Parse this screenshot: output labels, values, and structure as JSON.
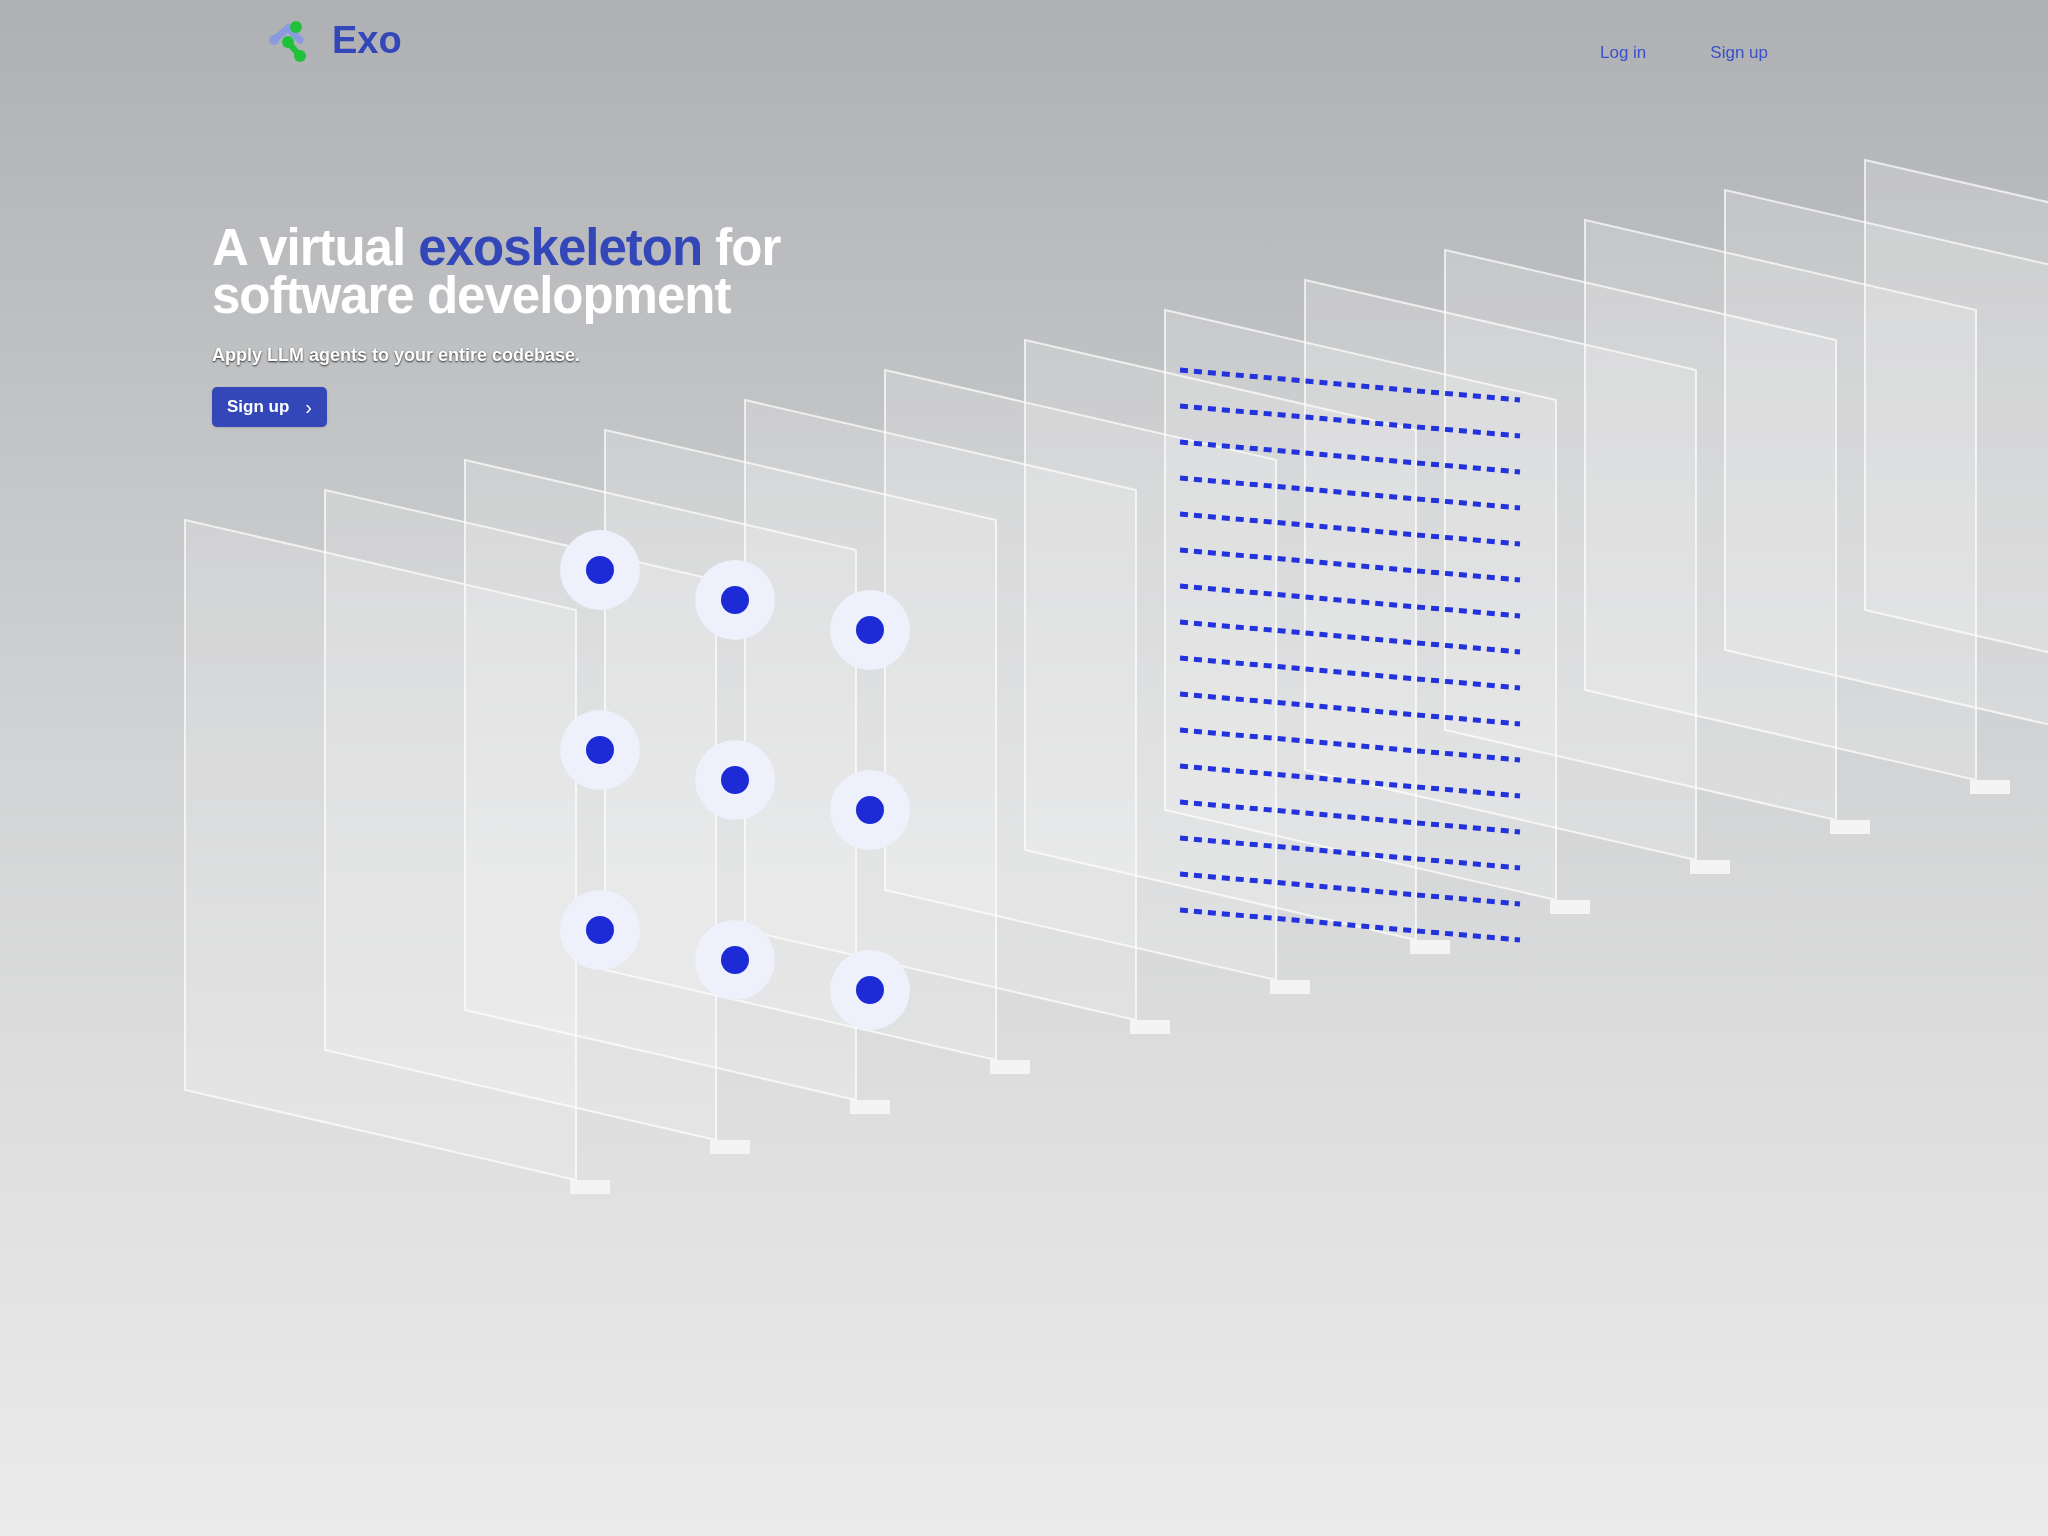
{
  "header": {
    "logo_text": "Exo",
    "nav": [
      {
        "label": "Log in"
      },
      {
        "label": "Sign up"
      }
    ]
  },
  "hero": {
    "headline": [
      {
        "text": "A virtual ",
        "highlight": false
      },
      {
        "text": "exoskeleton",
        "highlight": true
      },
      {
        "text": " for software development",
        "highlight": false
      }
    ],
    "subtitle": "Apply LLM agents to your entire codebase.",
    "cta": {
      "label": "Sign up",
      "icon": "›"
    }
  }
}
